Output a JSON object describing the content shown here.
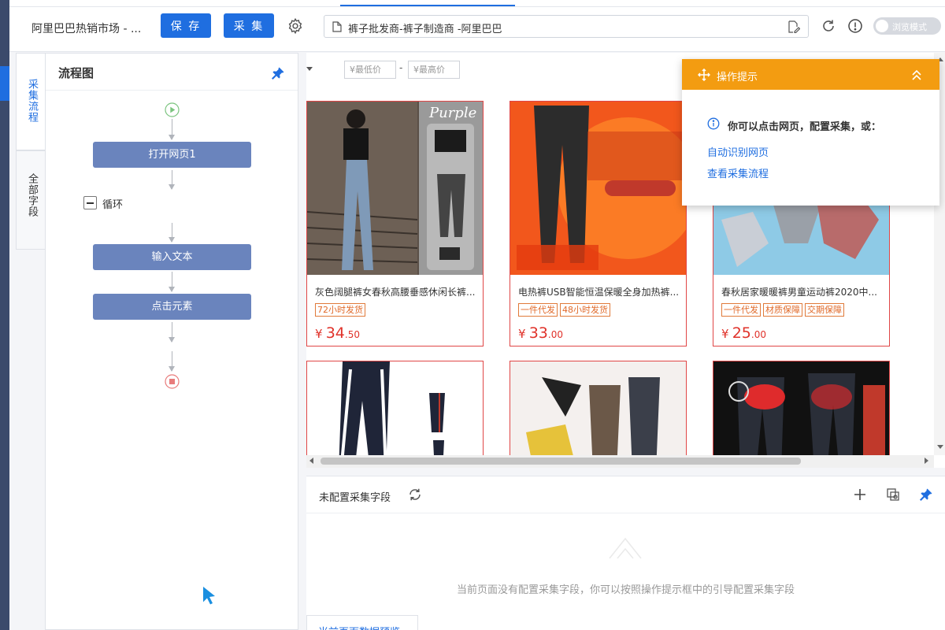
{
  "header": {
    "task_title": "阿里巴巴热销市场 - ...",
    "save_label": "保 存",
    "collect_label": "采 集",
    "url_text": "裤子批发商-裤子制造商 -阿里巴巴",
    "browse_mode_label": "浏览模式"
  },
  "side_tabs": [
    "采集流程",
    "全部字段"
  ],
  "flow": {
    "title": "流程图",
    "nodes": [
      "打开网页1",
      "输入文本",
      "点击元素"
    ],
    "loop_label": "循环"
  },
  "filter": {
    "min_placeholder": "¥最低价",
    "max_placeholder": "¥最高价",
    "dash": "-"
  },
  "products": [
    {
      "title": "灰色阔腿裤女春秋高腰垂感休闲长裤...",
      "tags": [
        "72小时发货"
      ],
      "currency": "¥",
      "price_int": "34",
      "price_dec": ".50"
    },
    {
      "title": "电热裤USB智能恒温保暖全身加热裤...",
      "tags": [
        "一件代发",
        "48小时发货"
      ],
      "currency": "¥",
      "price_int": "33",
      "price_dec": ".00"
    },
    {
      "title": "春秋居家暖暖裤男童运动裤2020中...",
      "tags": [
        "一件代发",
        "材质保障",
        "交期保障"
      ],
      "currency": "¥",
      "price_int": "25",
      "price_dec": ".00"
    }
  ],
  "tips": {
    "title": "操作提示",
    "message": "你可以点击网页，配置采集，或：",
    "link_auto": "自动识别网页",
    "link_flow": "查看采集流程"
  },
  "fields": {
    "title": "未配置采集字段",
    "empty_text": "当前页面没有配置采集字段，你可以按照操作提示框中的引导配置采集字段",
    "preview_tab": "当前页面数据预览"
  },
  "colors": {
    "accent": "#1f6ee0",
    "tips_header": "#f39c11",
    "flow_node": "#6a84bd",
    "price_red": "#e0322a"
  },
  "icons": [
    "gear-icon",
    "doc-icon",
    "edit-icon",
    "refresh-icon",
    "info-icon",
    "pin-icon",
    "play-icon",
    "stop-icon",
    "move-icon",
    "chevrons-up-icon",
    "plus-icon",
    "copy-icon",
    "cursor-icon"
  ]
}
